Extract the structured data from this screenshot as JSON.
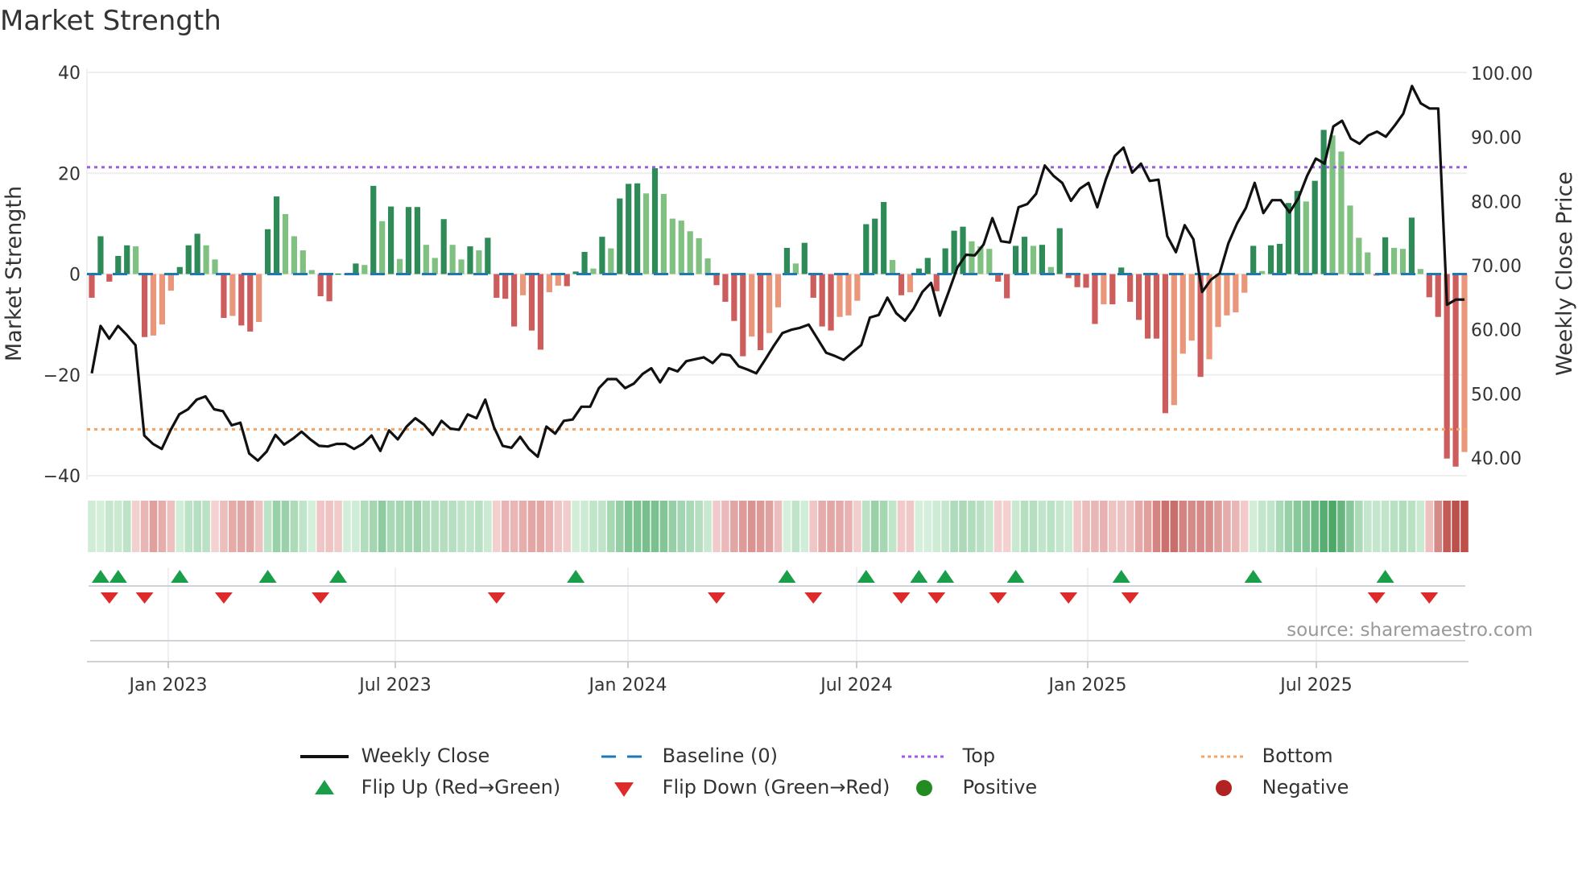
{
  "title": "Market Strength",
  "source": "source: sharemaestro.com",
  "colors": {
    "strong_up": "#2e8b57",
    "weak_up": "#80c080",
    "strong_down": "#cd5c5c",
    "weak_down": "#e9967a",
    "baseline": "#1f77b4",
    "top": "#9b5de5",
    "bottom": "#f4a460",
    "line": "#111111",
    "flip_up": "#1a9e4a",
    "flip_down": "#dd2a2a",
    "positive": "#228b22",
    "negative": "#b22222"
  },
  "legend": [
    {
      "label": "Weekly Close",
      "symbol": "line"
    },
    {
      "label": "Baseline (0)",
      "symbol": "dash"
    },
    {
      "label": "Top",
      "symbol": "dot-top"
    },
    {
      "label": "Bottom",
      "symbol": "dot-bottom"
    },
    {
      "label": "Flip Up (Red→Green)",
      "symbol": "tri-up"
    },
    {
      "label": "Flip Down (Green→Red)",
      "symbol": "tri-down"
    },
    {
      "label": "Positive",
      "symbol": "circle-pos"
    },
    {
      "label": "Negative",
      "symbol": "circle-neg"
    }
  ],
  "chart_data": {
    "type": "bar",
    "title": "Market Strength",
    "ylabel": "Market Strength",
    "y2label": "Weekly Close Price",
    "ylim": [
      -40,
      40
    ],
    "y2lim": [
      40,
      100
    ],
    "yticks": [
      "40",
      "20",
      "0",
      "−20",
      "−40"
    ],
    "y2ticks": [
      "100.00",
      "90.00",
      "80.00",
      "70.00",
      "60.00",
      "50.00",
      "40.00"
    ],
    "xticks": [
      "Jan 2023",
      "Jul 2023",
      "Jan 2024",
      "Jul 2024",
      "Jan 2025",
      "Jul 2025"
    ],
    "top_level": 21.2,
    "bottom_level": -30.8,
    "grid": true,
    "legend_position": "bottom",
    "strength": [
      -4.7,
      7.5,
      -1.5,
      3.6,
      5.7,
      5.5,
      -12.5,
      -12.2,
      -10.0,
      -3.3,
      1.4,
      5.7,
      8.0,
      5.7,
      2.9,
      -8.7,
      -8.3,
      -10.2,
      -11.4,
      -9.5,
      8.9,
      15.4,
      11.9,
      7.5,
      4.7,
      0.8,
      -4.4,
      -5.4,
      0.1,
      0.1,
      2.1,
      1.8,
      17.5,
      10.5,
      13.4,
      3.0,
      13.3,
      13.3,
      5.8,
      3.2,
      10.9,
      5.8,
      2.9,
      5.5,
      4.7,
      7.2,
      -4.7,
      -4.9,
      -10.4,
      -4.2,
      -11.2,
      -15.0,
      -3.6,
      -2.3,
      -2.4,
      0.5,
      4.4,
      1.1,
      7.4,
      5.1,
      15.0,
      17.9,
      18.0,
      16.0,
      21.0,
      15.9,
      11.0,
      10.6,
      8.5,
      7.1,
      3.1,
      -2.2,
      -5.5,
      -9.3,
      -16.3,
      -12.4,
      -15.1,
      -11.7,
      -6.6,
      5.2,
      2.1,
      6.2,
      -4.7,
      -10.4,
      -11.2,
      -8.5,
      -8.2,
      -5.3,
      9.9,
      11.0,
      14.3,
      2.8,
      -4.2,
      -3.6,
      1.1,
      3.2,
      -3.4,
      5.1,
      8.6,
      9.4,
      6.5,
      5.5,
      5.0,
      -1.5,
      -4.8,
      5.6,
      7.4,
      5.6,
      5.8,
      1.4,
      9.1,
      -0.8,
      -2.6,
      -2.7,
      -9.9,
      -6.0,
      -6.0,
      1.3,
      -5.5,
      -9.1,
      -12.8,
      -12.8,
      -27.6,
      -26.0,
      -15.8,
      -13.2,
      -20.4,
      -16.9,
      -10.5,
      -8.2,
      -7.6,
      -3.7,
      5.6,
      0.6,
      5.7,
      6.0,
      14.1,
      16.5,
      14.4,
      18.5,
      28.6,
      27.5,
      24.3,
      13.6,
      7.2,
      4.3,
      -0.3,
      7.3,
      5.2,
      5.0,
      11.2,
      1.0,
      -4.6,
      -8.5,
      -36.6,
      -38.2,
      -35.3
    ],
    "weekly_close": [
      53.2,
      60.6,
      58.6,
      60.6,
      59.2,
      57.6,
      43.5,
      42.2,
      41.4,
      44.3,
      46.8,
      47.6,
      49.1,
      49.6,
      47.6,
      47.3,
      45.1,
      45.5,
      40.7,
      39.6,
      41.0,
      43.6,
      42.1,
      43.0,
      44.1,
      42.9,
      41.9,
      41.8,
      42.2,
      42.2,
      41.4,
      42.2,
      43.5,
      41.1,
      44.3,
      42.9,
      44.9,
      46.2,
      45.2,
      43.6,
      45.8,
      44.6,
      44.4,
      46.8,
      46.2,
      49.1,
      44.8,
      41.9,
      41.6,
      43.3,
      41.4,
      40.2,
      44.9,
      43.8,
      45.8,
      46.0,
      48.0,
      48.0,
      50.9,
      52.3,
      52.3,
      50.9,
      51.6,
      53.1,
      54.0,
      51.8,
      54.0,
      53.5,
      55.1,
      55.4,
      55.7,
      54.8,
      56.2,
      56.0,
      54.3,
      53.8,
      53.2,
      55.3,
      57.5,
      59.5,
      60.0,
      60.3,
      60.8,
      58.6,
      56.4,
      55.9,
      55.3,
      56.5,
      57.6,
      61.9,
      62.3,
      65.0,
      62.6,
      61.4,
      63.3,
      65.9,
      67.3,
      62.2,
      65.9,
      69.7,
      71.7,
      71.6,
      73.3,
      77.4,
      73.8,
      73.6,
      79.1,
      79.6,
      81.2,
      85.6,
      84.0,
      82.9,
      80.1,
      82.0,
      82.9,
      79.1,
      83.5,
      87.1,
      88.4,
      84.5,
      85.9,
      83.2,
      83.4,
      74.6,
      72.1,
      76.3,
      74.1,
      65.9,
      67.8,
      68.8,
      73.5,
      76.6,
      79.0,
      82.9,
      78.2,
      80.2,
      80.2,
      78.3,
      80.5,
      84.0,
      86.7,
      85.9,
      91.7,
      92.6,
      89.8,
      89.0,
      90.3,
      90.9,
      90.1,
      91.8,
      93.7,
      98.0,
      95.3,
      94.5,
      94.5,
      63.9,
      64.7,
      64.7
    ],
    "flip_up_weeks": [
      1,
      3,
      10,
      20,
      28,
      55,
      79,
      88,
      94,
      97,
      105,
      117,
      132,
      147
    ],
    "flip_down_weeks": [
      2,
      6,
      15,
      26,
      46,
      71,
      82,
      92,
      96,
      103,
      111,
      118,
      146,
      152
    ]
  }
}
